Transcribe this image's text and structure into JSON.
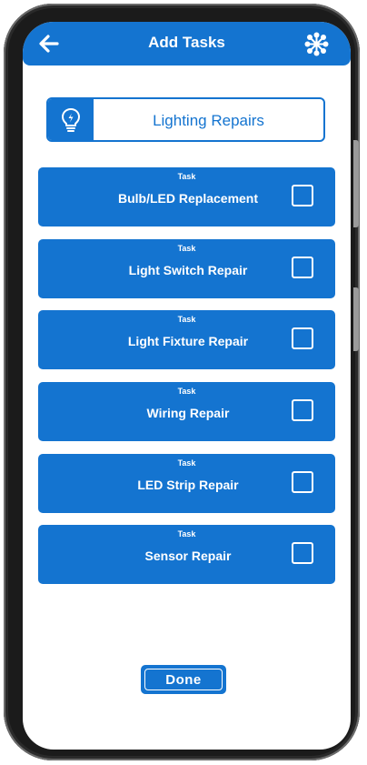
{
  "header": {
    "title": "Add Tasks",
    "back_icon": "arrow-left-icon",
    "menu_icon": "nodes-menu-icon"
  },
  "category": {
    "label": "Lighting Repairs",
    "icon": "lightbulb-icon"
  },
  "tasks": [
    {
      "tag": "Task",
      "name": "Bulb/LED Replacement",
      "checked": false
    },
    {
      "tag": "Task",
      "name": "Light Switch Repair",
      "checked": false
    },
    {
      "tag": "Task",
      "name": "Light Fixture Repair",
      "checked": false
    },
    {
      "tag": "Task",
      "name": "Wiring Repair",
      "checked": false
    },
    {
      "tag": "Task",
      "name": "LED Strip Repair",
      "checked": false
    },
    {
      "tag": "Task",
      "name": "Sensor Repair",
      "checked": false
    }
  ],
  "footer": {
    "done_label": "Done"
  },
  "colors": {
    "primary": "#1474d0",
    "background": "#ffffff",
    "text_on_primary": "#ffffff"
  }
}
